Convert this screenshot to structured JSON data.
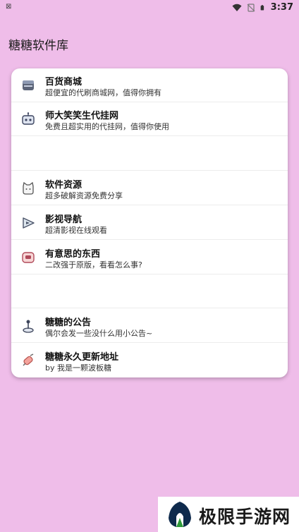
{
  "status_bar": {
    "left_icon": "sim-icon",
    "time": "3:37"
  },
  "app": {
    "title": "糖糖软件库"
  },
  "items": [
    {
      "title": "百货商城",
      "subtitle": "超便宜的代刷商城网，值得你拥有",
      "icon": "store-icon"
    },
    {
      "title": "师大笑笑生代挂网",
      "subtitle": "免费且超实用的代挂网，值得你使用",
      "icon": "robot-icon"
    },
    {
      "title": "",
      "subtitle": ""
    },
    {
      "title": "软件资源",
      "subtitle": "超多破解资源免费分享",
      "icon": "cat-icon"
    },
    {
      "title": "影视导航",
      "subtitle": "超清影视在线观看",
      "icon": "play-icon"
    },
    {
      "title": "有意思的东西",
      "subtitle": "二改强于原版，看看怎么事?",
      "icon": "tv-icon"
    },
    {
      "title": "",
      "subtitle": ""
    },
    {
      "title": "糖糖的公告",
      "subtitle": "偶尔会发一些没什么用小公告~",
      "icon": "joystick-icon"
    },
    {
      "title": "糖糖永久更新地址",
      "subtitle": "by 我是一颗波板糖",
      "icon": "candy-icon"
    }
  ],
  "watermark": {
    "text": "极限手游网"
  },
  "colors": {
    "background": "#efbde9",
    "card": "#ffffff"
  }
}
